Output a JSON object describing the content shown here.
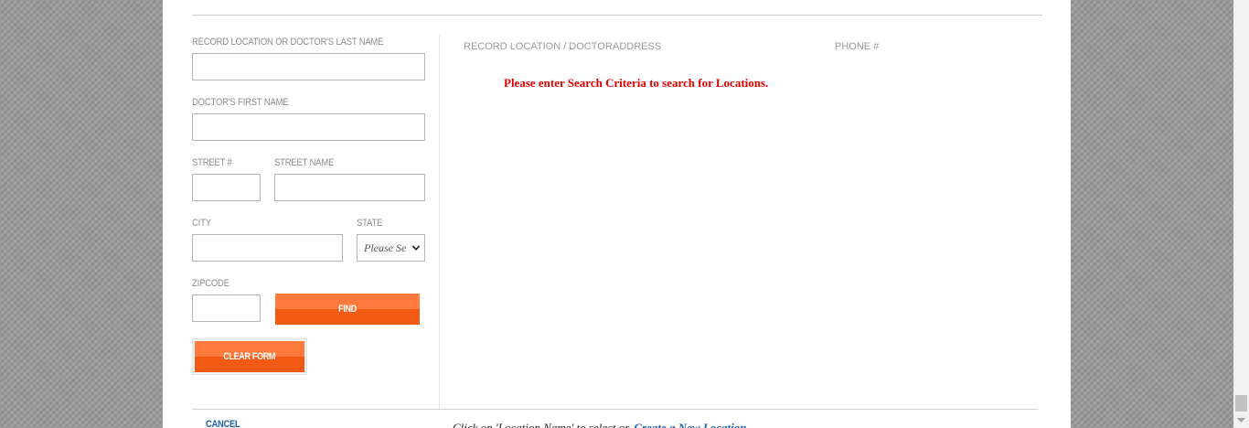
{
  "form": {
    "last_name_label": "RECORD LOCATION OR DOCTOR'S LAST NAME",
    "last_name_value": "",
    "first_name_label": "DOCTOR'S FIRST NAME",
    "first_name_value": "",
    "street_num_label": "STREET #",
    "street_num_value": "",
    "street_name_label": "STREET NAME",
    "street_name_value": "",
    "city_label": "CITY",
    "city_value": "",
    "state_label": "STATE",
    "state_selected": "Please Select",
    "zipcode_label": "ZIPCODE",
    "zipcode_value": "",
    "find_label": "FIND",
    "clear_label": "CLEAR FORM"
  },
  "results": {
    "col_location": "RECORD LOCATION / DOCTOR",
    "col_address": "ADDRESS",
    "col_phone": "PHONE #",
    "message": "Please enter Search Criteria to search for Locations."
  },
  "footer": {
    "cancel_label": "CANCEL",
    "note": "Click on 'Location Name' to select or",
    "create_label": "Create a New Location"
  },
  "colors": {
    "accent_orange": "#f35a14",
    "message_red": "#e00000",
    "link_blue": "#1d5fa8"
  }
}
